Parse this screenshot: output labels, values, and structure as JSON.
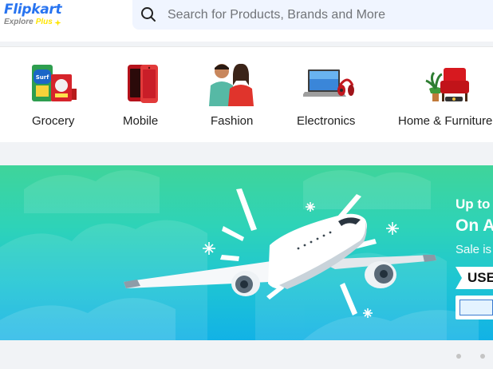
{
  "header": {
    "logo_text": "Flipkart",
    "logo_subtext": "Explore",
    "logo_plus": "Plus",
    "search_placeholder": "Search for Products, Brands and More"
  },
  "categories": [
    {
      "label": "Grocery",
      "icon": "grocery-icon"
    },
    {
      "label": "Mobile",
      "icon": "mobile-phone-icon"
    },
    {
      "label": "Fashion",
      "icon": "fashion-people-icon"
    },
    {
      "label": "Electronics",
      "icon": "laptop-headphones-icon"
    },
    {
      "label": "Home & Furniture",
      "icon": "armchair-icon"
    }
  ],
  "banner": {
    "line1": "Up to",
    "line2": "On A",
    "line3": "Sale is",
    "code_label": "USE",
    "bank_logo": "bank-logo"
  },
  "carousel": {
    "dot_count": 2
  },
  "colors": {
    "brand_blue": "#2874f0",
    "brand_yellow": "#ffe500",
    "search_bg": "#f0f5ff",
    "banner_top": "#3fd49a",
    "banner_bottom": "#12b2e6"
  }
}
